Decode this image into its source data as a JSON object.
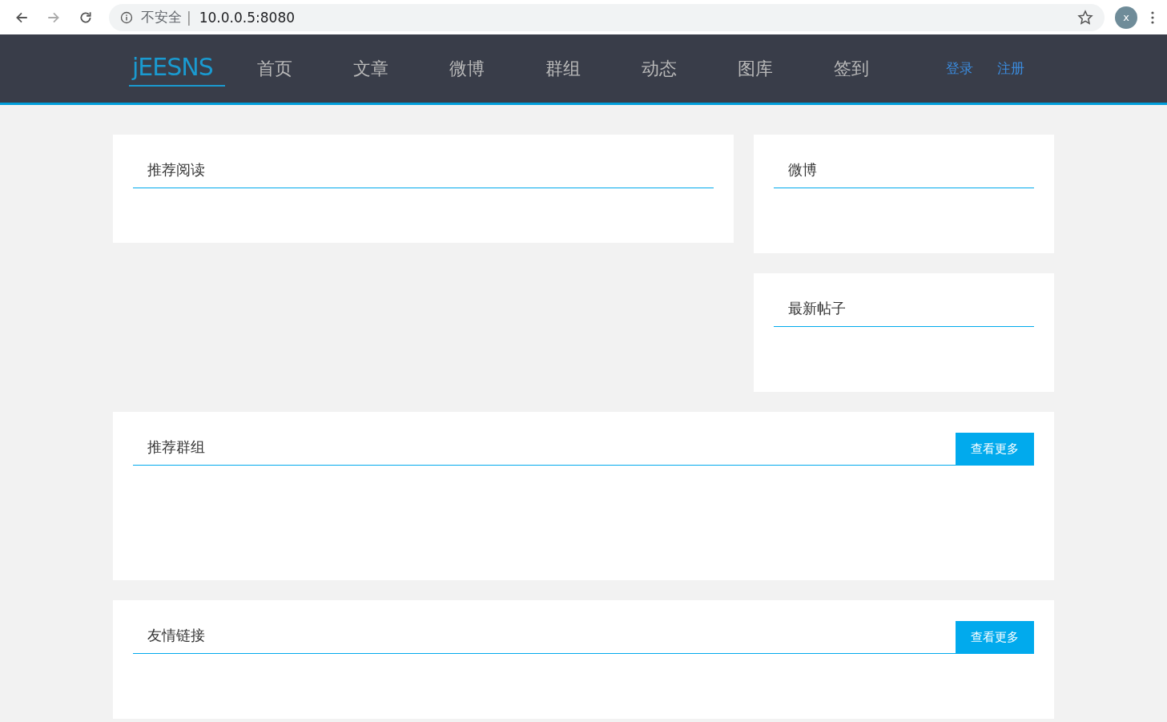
{
  "browser": {
    "security_label": "不安全",
    "separator": "|",
    "url": "10.0.0.5:8080",
    "avatar_letter": "x",
    "forward_disabled": true
  },
  "navbar": {
    "logo": "jEESNS",
    "items": [
      {
        "label": "首页"
      },
      {
        "label": "文章"
      },
      {
        "label": "微博"
      },
      {
        "label": "群组"
      },
      {
        "label": "动态"
      },
      {
        "label": "图库"
      },
      {
        "label": "签到"
      }
    ],
    "account_links": [
      {
        "label": "登录"
      },
      {
        "label": "注册"
      }
    ]
  },
  "recommended_reading": {
    "title": "推荐阅读"
  },
  "sidebar": [
    {
      "title": "微博"
    },
    {
      "title": "最新帖子"
    }
  ],
  "recommended_groups": {
    "title": "推荐群组",
    "more_button": "查看更多"
  },
  "friend_links": {
    "title": "友情链接",
    "more_button": "查看更多"
  }
}
